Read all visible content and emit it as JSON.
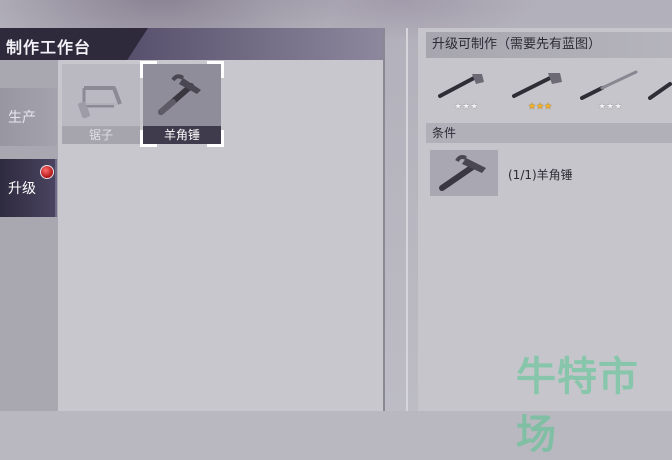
{
  "header": {
    "title": "制作工作台"
  },
  "tabs": [
    {
      "label": "生产",
      "active": false
    },
    {
      "label": "升级",
      "active": true,
      "notification": true
    }
  ],
  "items": [
    {
      "label": "锯子",
      "icon": "hacksaw-icon",
      "selected": false
    },
    {
      "label": "羊角锤",
      "icon": "claw-hammer-icon",
      "selected": true
    }
  ],
  "upgrades": {
    "header": "升级可制作（需要先有蓝图）",
    "items": [
      {
        "icon": "wrench-icon",
        "stars": "★★★",
        "star_color": "white"
      },
      {
        "icon": "wrench-icon",
        "stars": "★★★",
        "star_color": "gold"
      },
      {
        "icon": "knife-icon",
        "stars": "★★★",
        "star_color": "white"
      },
      {
        "icon": "knife-icon",
        "stars": "",
        "star_color": "white"
      }
    ]
  },
  "conditions": {
    "header": "条件",
    "items": [
      {
        "icon": "claw-hammer-icon",
        "text": "(1/1)羊角锤"
      }
    ]
  },
  "watermark": "牛特市场",
  "colors": {
    "accent_dark": "#2e2a3c",
    "notification_red": "#c81c1c",
    "gold_star": "#f5b320"
  }
}
